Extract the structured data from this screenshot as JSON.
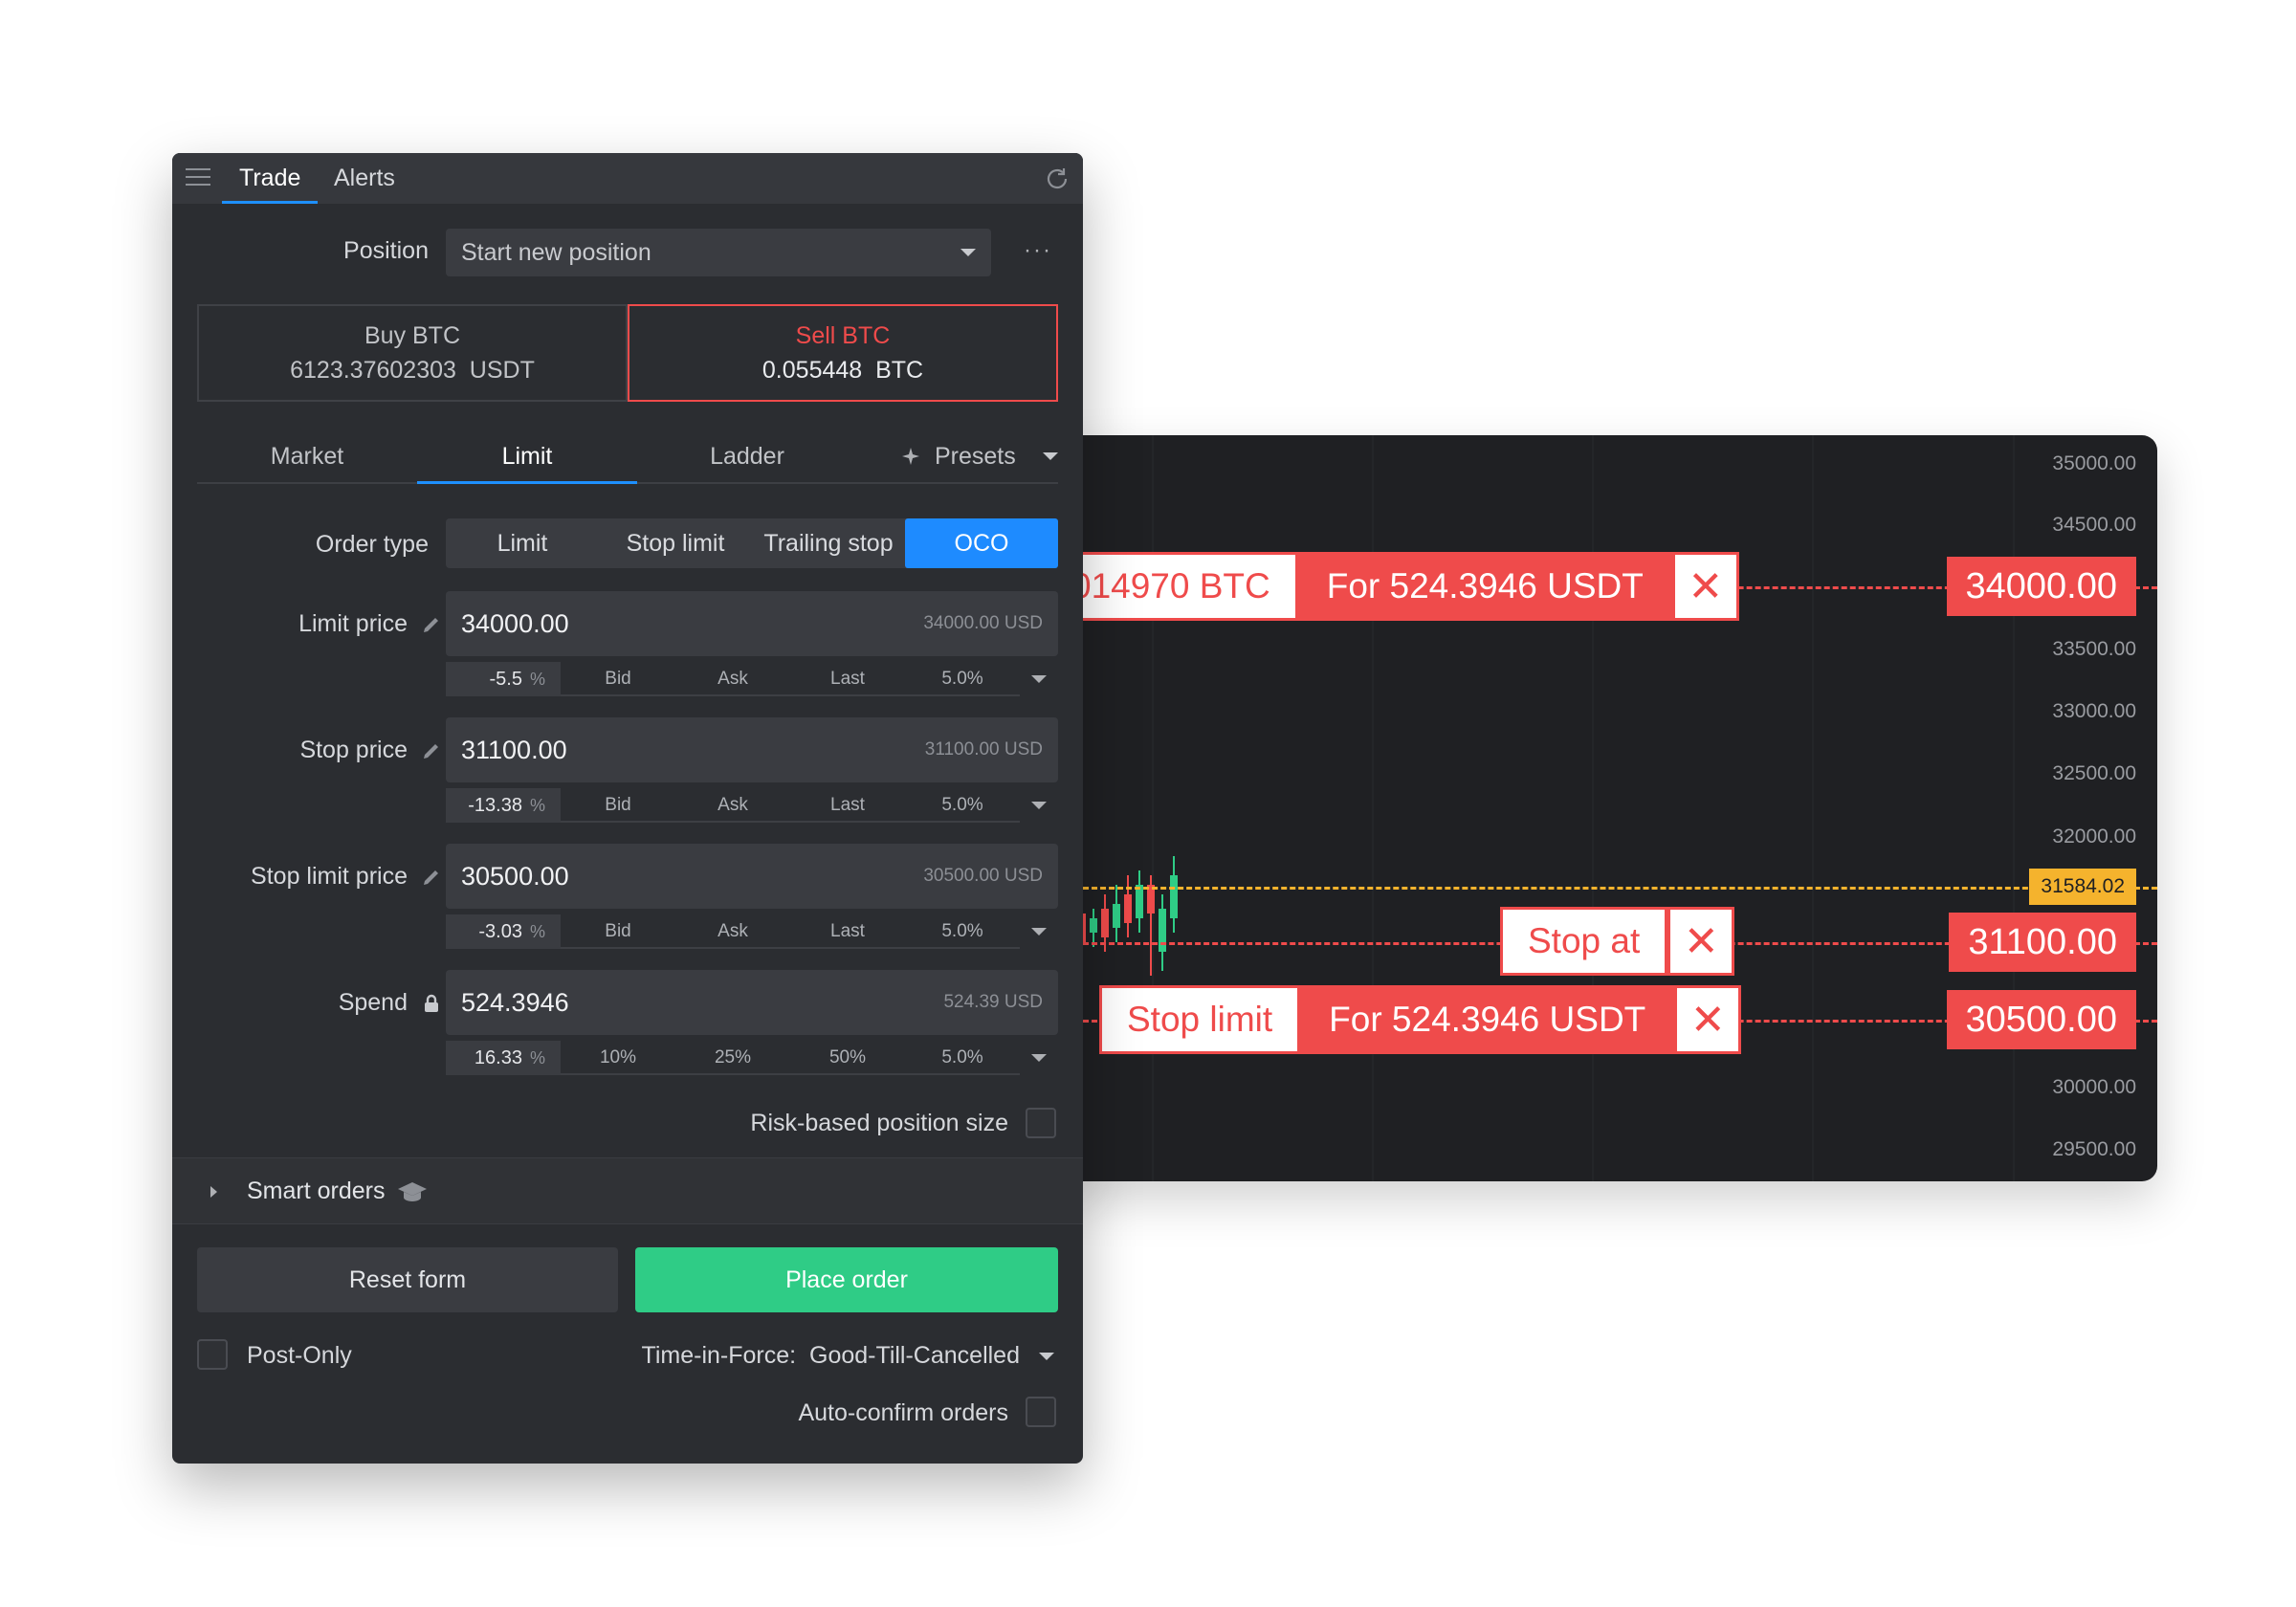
{
  "chart": {
    "y_axis": [
      "35000.00",
      "34500.00",
      "34000.00",
      "33500.00",
      "33000.00",
      "32500.00",
      "32000.00",
      "31584.02",
      "31100.00",
      "30500.00",
      "30000.00",
      "29500.00"
    ],
    "current_price": "31584.02",
    "orders": [
      {
        "left_text": "014970 BTC",
        "right_text": "For 524.3946 USDT",
        "price": "34000.00"
      },
      {
        "left_text": "Stop at",
        "price": "31100.00"
      },
      {
        "left_text": "Stop limit",
        "right_text": "For 524.3946 USDT",
        "price": "30500.00"
      }
    ],
    "colors": {
      "sell": "#ef4b4b",
      "current": "#f5b32d",
      "bull": "#2fcc86",
      "bear": "#ef4b4b"
    }
  },
  "panel": {
    "tabs": [
      "Trade",
      "Alerts"
    ],
    "position_label": "Position",
    "position_value": "Start new position",
    "more": "···",
    "buy": {
      "title": "Buy BTC",
      "amount": "6123.37602303  USDT"
    },
    "sell": {
      "title": "Sell BTC",
      "amount": "0.055448  BTC"
    },
    "order_tabs": [
      "Market",
      "Limit",
      "Ladder"
    ],
    "presets": "Presets",
    "order_type_label": "Order type",
    "order_types": [
      "Limit",
      "Stop limit",
      "Trailing stop",
      "OCO"
    ],
    "fields": [
      {
        "label": "Limit price",
        "value": "34000.00",
        "hint": "34000.00 USD",
        "pct": "-5.5",
        "opts": [
          "Bid",
          "Ask",
          "Last",
          "5.0%"
        ]
      },
      {
        "label": "Stop price",
        "value": "31100.00",
        "hint": "31100.00 USD",
        "pct": "-13.38",
        "opts": [
          "Bid",
          "Ask",
          "Last",
          "5.0%"
        ]
      },
      {
        "label": "Stop limit price",
        "value": "30500.00",
        "hint": "30500.00 USD",
        "pct": "-3.03",
        "opts": [
          "Bid",
          "Ask",
          "Last",
          "5.0%"
        ]
      },
      {
        "label": "Spend",
        "value": "524.3946",
        "hint": "524.39 USD",
        "pct": "16.33",
        "opts": [
          "10%",
          "25%",
          "50%",
          "5.0%"
        ]
      }
    ],
    "pct_unit": "%",
    "risk_label": "Risk-based position size",
    "smart_orders": "Smart orders",
    "reset": "Reset form",
    "place": "Place order",
    "post_only": "Post-Only",
    "tif": "Time-in-Force:  Good-Till-Cancelled",
    "auto_confirm": "Auto-confirm orders"
  }
}
